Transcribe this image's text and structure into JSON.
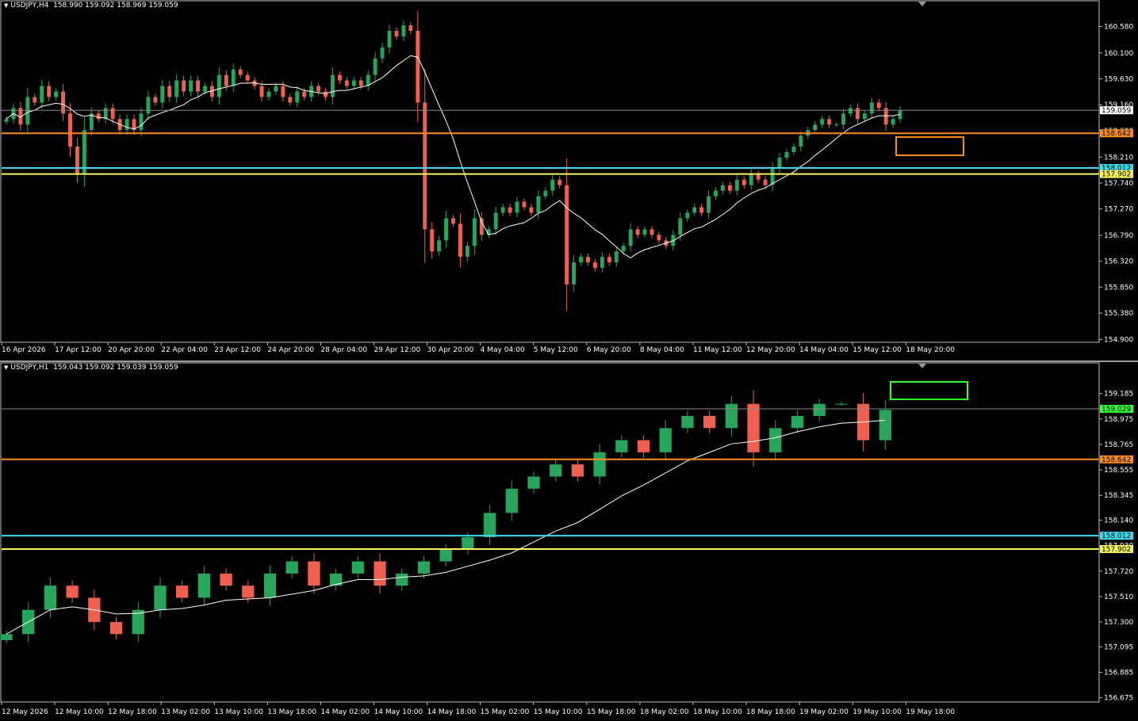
{
  "colors": {
    "background": "#000000",
    "bull": "#26a65b",
    "bear": "#f0604d",
    "ma": "#ffffff",
    "grid_axis": "#c0c0c0",
    "orange": "#ff8c1a",
    "cyan": "#3fd9f0",
    "yellow": "#f5f55a",
    "green": "#33ff33",
    "bid_line": "#8a8a8a"
  },
  "charts": {
    "top": {
      "symbol": "USDJPY,H4",
      "ohlc": "158.990 159.092 158.969 159.059",
      "price_range": [
        154.85,
        160.83
      ],
      "y_ticks": [
        "160.580",
        "160.100",
        "159.630",
        "159.160",
        "158.690",
        "158.210",
        "157.740",
        "157.270",
        "156.790",
        "156.320",
        "155.850",
        "155.380",
        "154.900"
      ],
      "x_labels": [
        "16 Apr 2026",
        "17 Apr 12:00",
        "20 Apr 20:00",
        "22 Apr 04:00",
        "23 Apr 12:00",
        "24 Apr 20:00",
        "28 Apr 04:00",
        "29 Apr 12:00",
        "30 Apr 20:00",
        "4 May 04:00",
        "5 May 12:00",
        "6 May 20:00",
        "8 May 04:00",
        "11 May 12:00",
        "12 May 20:00",
        "14 May 04:00",
        "15 May 12:00",
        "18 May 20:00"
      ],
      "levels": [
        {
          "price": 158.642,
          "label": "158.642",
          "color": "#ff8c1a"
        },
        {
          "price": 158.012,
          "label": "158.012",
          "color": "#3fd9f0"
        },
        {
          "price": 157.902,
          "label": "157.902",
          "color": "#f5f55a"
        }
      ],
      "bid": {
        "price": 159.059,
        "label": "159.059"
      },
      "box": {
        "color": "#ff8c1a"
      }
    },
    "bottom": {
      "symbol": "USDJPY,H1",
      "ohlc": "159.043 159.092 159.039 159.059",
      "price_range": [
        156.64,
        159.34
      ],
      "y_ticks": [
        "159.185",
        "158.975",
        "158.765",
        "158.555",
        "158.345",
        "158.140",
        "157.930",
        "157.720",
        "157.510",
        "157.300",
        "157.095",
        "156.885",
        "156.675"
      ],
      "x_labels": [
        "12 May 2026",
        "12 May 10:00",
        "12 May 18:00",
        "13 May 02:00",
        "13 May 10:00",
        "13 May 18:00",
        "14 May 02:00",
        "14 May 10:00",
        "14 May 18:00",
        "15 May 02:00",
        "15 May 10:00",
        "15 May 18:00",
        "18 May 02:00",
        "18 May 10:00",
        "18 May 18:00",
        "19 May 02:00",
        "19 May 10:00",
        "19 May 18:00"
      ],
      "levels": [
        {
          "price": 158.642,
          "label": "158.642",
          "color": "#ff8c1a"
        },
        {
          "price": 158.012,
          "label": "158.012",
          "color": "#3fd9f0"
        },
        {
          "price": 157.902,
          "label": "157.902",
          "color": "#f5f55a"
        }
      ],
      "bid": {
        "price": 159.059,
        "label": "159.029"
      },
      "box": {
        "color": "#33ff33"
      }
    }
  },
  "chart_data": [
    {
      "type": "candlestick",
      "title": "USDJPY,H4 158.990 159.092 158.969 159.059",
      "ylim": [
        154.85,
        160.83
      ],
      "series": [
        {
          "values": [
            158.9,
            159.1,
            158.8,
            159.3,
            159.2,
            159.5,
            159.3,
            159.4,
            159.0,
            158.4,
            157.9,
            158.7,
            159.0,
            158.9,
            159.1,
            158.9,
            158.7,
            158.9,
            158.7,
            159.0,
            159.3,
            159.2,
            159.5,
            159.3,
            159.6,
            159.4,
            159.6,
            159.4,
            159.5,
            159.3,
            159.7,
            159.5,
            159.8,
            159.7,
            159.6,
            159.5,
            159.3,
            159.4,
            159.5,
            159.3,
            159.2,
            159.4,
            159.3,
            159.5,
            159.4,
            159.3,
            159.7,
            159.6,
            159.5,
            159.6,
            159.5,
            159.7,
            160.0,
            160.2,
            160.5,
            160.4,
            160.6,
            160.5,
            159.2,
            156.9,
            156.5,
            156.7,
            157.1,
            157.0,
            156.4,
            156.6,
            157.1,
            156.8,
            156.9,
            157.2,
            157.3,
            157.2,
            157.4,
            157.3,
            157.2,
            157.5,
            157.6,
            157.8,
            157.7,
            155.9,
            156.3,
            156.4,
            156.3,
            156.2,
            156.4,
            156.3,
            156.5,
            156.6,
            156.9,
            156.8,
            156.9,
            156.8,
            156.7,
            156.6,
            156.8,
            157.1,
            157.2,
            157.3,
            157.2,
            157.5,
            157.6,
            157.7,
            157.6,
            157.8,
            157.7,
            157.9,
            157.8,
            157.7,
            158.0,
            158.2,
            158.3,
            158.4,
            158.6,
            158.7,
            158.8,
            158.9,
            158.8,
            158.8,
            159.0,
            159.1,
            158.9,
            159.0,
            159.2,
            159.1,
            158.8,
            158.9,
            159.06
          ]
        }
      ],
      "annotations": [
        "158.642",
        "158.012",
        "157.902",
        "159.059"
      ]
    },
    {
      "type": "candlestick",
      "title": "USDJPY,H1 159.043 159.092 159.039 159.059",
      "ylim": [
        156.64,
        159.34
      ],
      "series": [
        {
          "values": [
            157.2,
            157.4,
            157.6,
            157.5,
            157.3,
            157.2,
            157.4,
            157.6,
            157.5,
            157.7,
            157.6,
            157.5,
            157.7,
            157.8,
            157.6,
            157.7,
            157.8,
            157.6,
            157.7,
            157.8,
            157.9,
            158.0,
            158.2,
            158.4,
            158.5,
            158.6,
            158.5,
            158.7,
            158.8,
            158.7,
            158.9,
            159.0,
            158.9,
            159.1,
            158.7,
            158.9,
            159.0,
            159.1,
            159.1,
            158.8,
            159.05
          ]
        }
      ],
      "annotations": [
        "158.642",
        "158.012",
        "157.902",
        "159.029"
      ]
    }
  ]
}
